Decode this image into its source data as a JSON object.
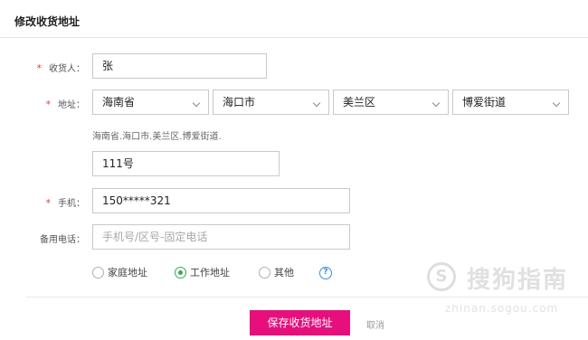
{
  "header": {
    "title": "修改收货地址"
  },
  "form": {
    "recipient": {
      "label": "收货人：",
      "required_mark": "*",
      "value": "张"
    },
    "region": {
      "label": "地址：",
      "required_mark": "*",
      "province": "海南省",
      "city": "海口市",
      "district": "美兰区",
      "street": "博爱街道"
    },
    "region_summary": "海南省.海口市.美兰区.博爱街道.",
    "detail_address": {
      "value": "111号"
    },
    "phone": {
      "label": "手机：",
      "required_mark": "*",
      "value": "150*****321"
    },
    "backup_phone": {
      "label": "备用电话：",
      "placeholder": "手机号/区号-固定电话"
    },
    "address_type": {
      "options": [
        "家庭地址",
        "工作地址",
        "其他"
      ],
      "selected": "工作地址"
    },
    "help_icon_glyph": "?"
  },
  "actions": {
    "save_label": "保存收货地址",
    "cancel_label": "取消"
  },
  "watermark": {
    "logo_glyph": "S",
    "brand": "搜狗指南",
    "url": "zhinan.sogou.com"
  },
  "colors": {
    "accent": "#e60f7c",
    "required": "#e4393c",
    "radio_checked": "#3aa657",
    "help": "#3b8ae8"
  }
}
